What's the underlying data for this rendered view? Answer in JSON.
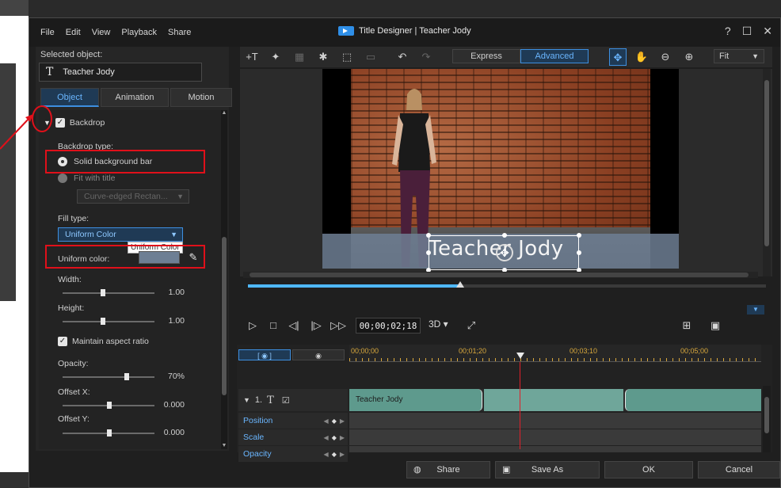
{
  "window": {
    "title": "Title Designer  |  Teacher Jody",
    "menu": [
      "File",
      "Edit",
      "View",
      "Playback",
      "Share"
    ],
    "controls": [
      "?",
      "☐",
      "✕"
    ]
  },
  "left_panel": {
    "selected_object_label": "Selected object:",
    "selected_object_value": "Teacher Jody",
    "tabs": [
      {
        "label": "Object",
        "active": true
      },
      {
        "label": "Animation",
        "active": false
      },
      {
        "label": "Motion",
        "active": false
      }
    ],
    "backdrop": {
      "label": "Backdrop",
      "checked": true,
      "type_label": "Backdrop type:",
      "option_solid": "Solid background bar",
      "option_fit": "Fit with title",
      "fit_dropdown": "Curve-edged Rectan...",
      "fill_type_label": "Fill type:",
      "fill_type_value": "Uniform Color",
      "fill_tooltip": "Uniform Color",
      "uniform_color_label": "Uniform color:",
      "uniform_color_value": "#6e7f94",
      "width_label": "Width:",
      "width_value": "1.00",
      "height_label": "Height:",
      "height_value": "1.00",
      "maintain_aspect_label": "Maintain aspect ratio",
      "maintain_aspect_checked": true,
      "opacity_label": "Opacity:",
      "opacity_value": "70%",
      "offset_x_label": "Offset X:",
      "offset_x_value": "0.000",
      "offset_y_label": "Offset Y:",
      "offset_y_value": "0.000"
    }
  },
  "toolbar": {
    "mode_express": "Express",
    "mode_advanced": "Advanced",
    "fit_value": "Fit"
  },
  "preview": {
    "title_text": "Teacher Jody",
    "backdrop_color": "#6e7f94"
  },
  "transport": {
    "timecode": "00;00;02;18",
    "mode3d": "3D",
    "progress": 0.41
  },
  "timeline": {
    "ruler_labels": [
      "00;00;00",
      "00;01;20",
      "00;03;10",
      "00;05;00"
    ],
    "track_number": "1.",
    "clip_label": "Teacher Jody",
    "rows": [
      "Position",
      "Scale",
      "Opacity"
    ]
  },
  "bottom_bar": {
    "share": "Share",
    "save_as": "Save As",
    "ok": "OK",
    "cancel": "Cancel"
  },
  "colors": {
    "accent": "#3d8fe0",
    "annotation_red": "#e0101a",
    "clip": "#6fa69a",
    "ruler_text": "#d9a83c"
  }
}
